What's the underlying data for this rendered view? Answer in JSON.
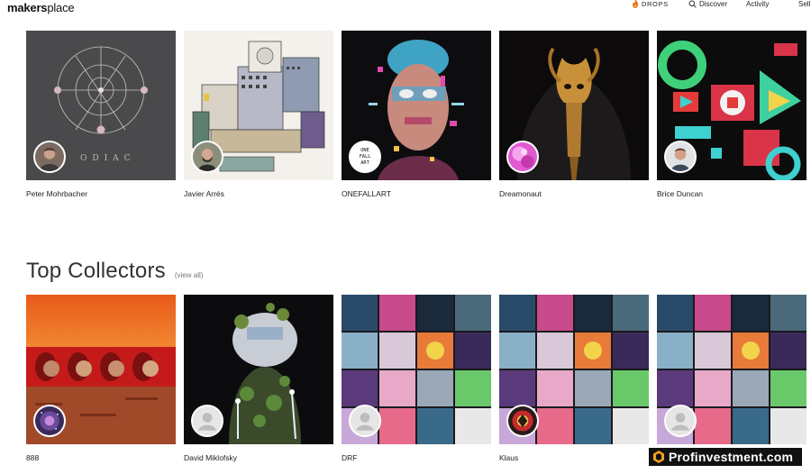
{
  "header": {
    "logo_prefix": "makers",
    "logo_suffix": "place",
    "nav": {
      "drops": "DROPS",
      "discover": "Discover",
      "activity": "Activity",
      "sell": "Sell"
    },
    "icons": {
      "drops": "flame-icon",
      "discover": "search-icon"
    }
  },
  "artists": [
    {
      "name": "Peter Mohrbacher",
      "art": "zodiac-circle-art",
      "avatar": "artist-avatar"
    },
    {
      "name": "Javier Arrés",
      "art": "isometric-city-art",
      "avatar": "artist-avatar"
    },
    {
      "name": "ONEFALLART",
      "art": "glitch-portrait-art",
      "avatar": "onefallart-logo"
    },
    {
      "name": "Dreamonaut",
      "art": "golden-skull-art",
      "avatar": "pink-abstract-avatar"
    },
    {
      "name": "Brice Duncan",
      "art": "geometric-shapes-art",
      "avatar": "artist-avatar"
    }
  ],
  "collectors_section": {
    "title": "Top Collectors",
    "view_all": "(view all)"
  },
  "collectors": [
    {
      "name": "888",
      "art": "red-figures-art",
      "avatar": "galaxy-avatar"
    },
    {
      "name": "David Miklofsky",
      "art": "cyber-bust-art",
      "avatar": "default-avatar"
    },
    {
      "name": "DRF",
      "art": "collage-art",
      "avatar": "default-avatar"
    },
    {
      "name": "Klaus",
      "art": "collage-art",
      "avatar": "red-emblem-avatar"
    },
    {
      "name": "",
      "art": "collage-art",
      "avatar": "default-avatar"
    }
  ],
  "watermark": {
    "text": "Profinvestment.com"
  },
  "colors": {
    "accent_orange": "#e86a1c",
    "text_dark": "#222222",
    "watermark_bg": "#111111"
  }
}
